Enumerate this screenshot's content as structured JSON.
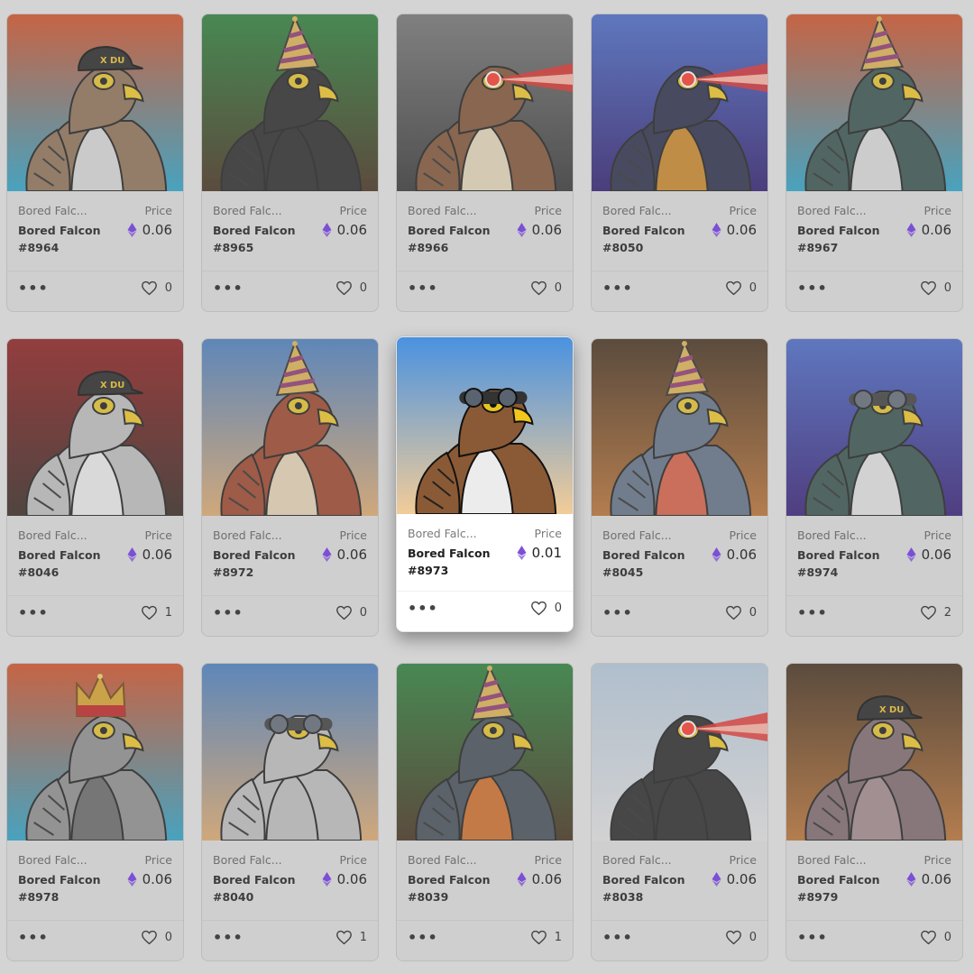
{
  "labels": {
    "price": "Price",
    "more": "•••"
  },
  "colors": {
    "eth": "#7b4fd6",
    "card_bg": "#cfcfcf",
    "page_bg": "#d4d4d4"
  },
  "cards": [
    {
      "collection": "Bored Falc...",
      "name": "Bored Falcon #8964",
      "price": "0.06",
      "likes": "0",
      "bg": [
        "#d2471a",
        "#1fa0c8"
      ],
      "body": "#8a6a4e",
      "chest": "#d9d9d9",
      "hat": "cap-icon",
      "active": false
    },
    {
      "collection": "Bored Falc...",
      "name": "Bored Falcon #8965",
      "price": "0.06",
      "likes": "0",
      "bg": [
        "#1f7a2e",
        "#3a2410"
      ],
      "body": "#1e1e1e",
      "chest": "#1e1e1e",
      "hat": "party-hat-icon",
      "active": false
    },
    {
      "collection": "Bored Falc...",
      "name": "Bored Falcon #8966",
      "price": "0.06",
      "likes": "0",
      "bg": [
        "#6e6e6e",
        "#2a2a2a"
      ],
      "body": "#7a4a2a",
      "chest": "#e7d7b8",
      "hat": "laser-eyes-icon",
      "active": false
    },
    {
      "collection": "Bored Falc...",
      "name": "Bored Falcon #8050",
      "price": "0.06",
      "likes": "0",
      "bg": [
        "#3f62c8",
        "#231068"
      ],
      "body": "#1f2340",
      "chest": "#c9821c",
      "hat": "laser-eyes-icon",
      "active": false
    },
    {
      "collection": "Bored Falc...",
      "name": "Bored Falcon #8967",
      "price": "0.06",
      "likes": "0",
      "bg": [
        "#d2471a",
        "#1fa0c8"
      ],
      "body": "#2c4a44",
      "chest": "#dcdcdc",
      "hat": "party-hat-icon",
      "active": false
    },
    {
      "collection": "Bored Falc...",
      "name": "Bored Falcon #8046",
      "price": "0.06",
      "likes": "1",
      "bg": [
        "#8a1010",
        "#2a1a14"
      ],
      "body": "#bdbdbd",
      "chest": "#eeeeee",
      "hat": "cap-icon",
      "active": false
    },
    {
      "collection": "Bored Falc...",
      "name": "Bored Falcon #8972",
      "price": "0.06",
      "likes": "0",
      "bg": [
        "#3f78c0",
        "#e0a868"
      ],
      "body": "#9a3a1e",
      "chest": "#e8d4b4",
      "hat": "party-hat-icon",
      "active": false
    },
    {
      "collection": "Bored Falc...",
      "name": "Bored Falcon #8973",
      "price": "0.01",
      "likes": "0",
      "bg": [
        "#4a92e0",
        "#f2cc98"
      ],
      "body": "#8a5a36",
      "chest": "#ececec",
      "hat": "goggles-icon",
      "active": true
    },
    {
      "collection": "Bored Falc...",
      "name": "Bored Falcon #8045",
      "price": "0.06",
      "likes": "0",
      "bg": [
        "#3a2410",
        "#b86a28"
      ],
      "body": "#5a6a80",
      "chest": "#d8563a",
      "hat": "party-hat-icon",
      "active": false
    },
    {
      "collection": "Bored Falc...",
      "name": "Bored Falcon #8974",
      "price": "0.06",
      "likes": "2",
      "bg": [
        "#3f62c8",
        "#2a1070"
      ],
      "body": "#2c4a44",
      "chest": "#e4e4e4",
      "hat": "goggles-icon",
      "active": false
    },
    {
      "collection": "Bored Falc...",
      "name": "Bored Falcon #8978",
      "price": "0.06",
      "likes": "0",
      "bg": [
        "#d2471a",
        "#1fa0c8"
      ],
      "body": "#8a8a8a",
      "chest": "#606060",
      "hat": "crown-icon",
      "active": false
    },
    {
      "collection": "Bored Falc...",
      "name": "Bored Falcon #8040",
      "price": "0.06",
      "likes": "1",
      "bg": [
        "#3f78c0",
        "#e0a868"
      ],
      "body": "#bdbdbd",
      "chest": "#bdbdbd",
      "hat": "goggles-icon",
      "active": false
    },
    {
      "collection": "Bored Falc...",
      "name": "Bored Falcon #8039",
      "price": "0.06",
      "likes": "1",
      "bg": [
        "#1f7a2e",
        "#3a2410"
      ],
      "body": "#3a4450",
      "chest": "#d0661c",
      "hat": "party-hat-icon",
      "active": false
    },
    {
      "collection": "Bored Falc...",
      "name": "Bored Falcon #8038",
      "price": "0.06",
      "likes": "0",
      "bg": [
        "#b4c8dc",
        "#e4e4e4"
      ],
      "body": "#1e1e1e",
      "chest": "#1e1e1e",
      "hat": "laser-eyes-icon",
      "active": false
    },
    {
      "collection": "Bored Falc...",
      "name": "Bored Falcon #8979",
      "price": "0.06",
      "likes": "0",
      "bg": [
        "#3a2410",
        "#b86a28"
      ],
      "body": "#7a6266",
      "chest": "#a08488",
      "hat": "cap-icon",
      "active": false
    }
  ]
}
